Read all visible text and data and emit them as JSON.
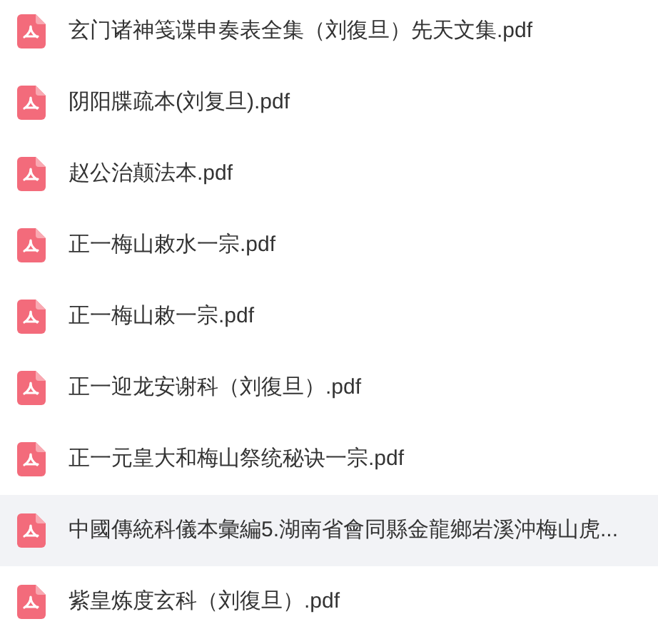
{
  "files": [
    {
      "name": "玄门诸神笺谍申奏表全集（刘復旦）先天文集.pdf",
      "hovered": false
    },
    {
      "name": "阴阳牒疏本(刘复旦).pdf",
      "hovered": false
    },
    {
      "name": "赵公治颠法本.pdf",
      "hovered": false
    },
    {
      "name": "正一梅山敕水一宗.pdf",
      "hovered": false
    },
    {
      "name": "正一梅山敕一宗.pdf",
      "hovered": false
    },
    {
      "name": "正一迎龙安谢科（刘復旦）.pdf",
      "hovered": false
    },
    {
      "name": "正一元皇大和梅山祭统秘诀一宗.pdf",
      "hovered": false
    },
    {
      "name": "中國傳統科儀本彙編5.湖南省會同縣金龍鄉岩溪沖梅山虎...",
      "hovered": true
    },
    {
      "name": "紫皇炼度玄科（刘復旦）.pdf",
      "hovered": false
    }
  ]
}
